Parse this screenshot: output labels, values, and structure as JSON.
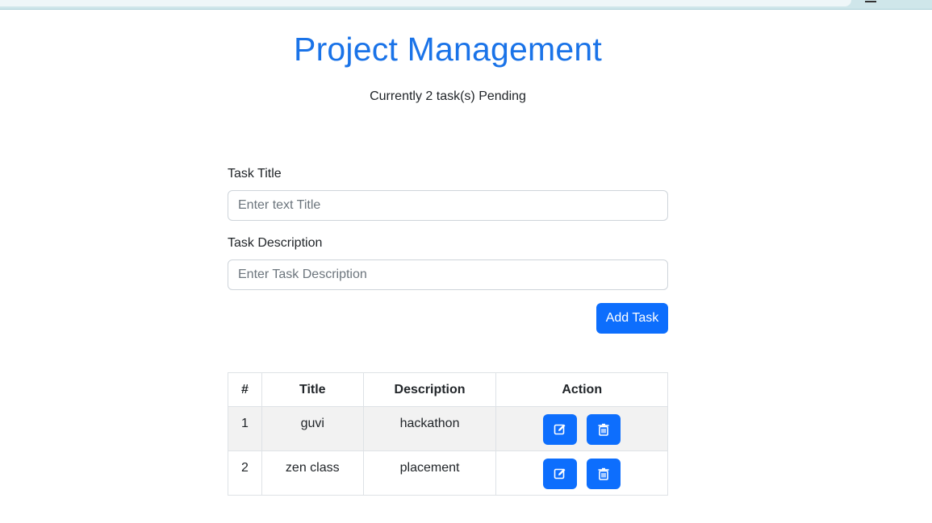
{
  "header": {
    "title": "Project Management",
    "pending_text": "Currently 2 task(s) Pending"
  },
  "form": {
    "title_label": "Task Title",
    "title_placeholder": "Enter text Title",
    "title_value": "",
    "description_label": "Task Description",
    "description_placeholder": "Enter Task Description",
    "description_value": "",
    "add_button_label": "Add Task"
  },
  "table": {
    "headers": [
      "#",
      "Title",
      "Description",
      "Action"
    ],
    "rows": [
      {
        "num": "1",
        "title": "guvi",
        "description": "hackathon"
      },
      {
        "num": "2",
        "title": "zen class",
        "description": "placement"
      }
    ],
    "row_actions": [
      "edit-icon",
      "trash-icon"
    ]
  },
  "colors": {
    "accent": "#0d6efd",
    "title": "#1a73e8",
    "stripe": "#f2f2f2"
  }
}
